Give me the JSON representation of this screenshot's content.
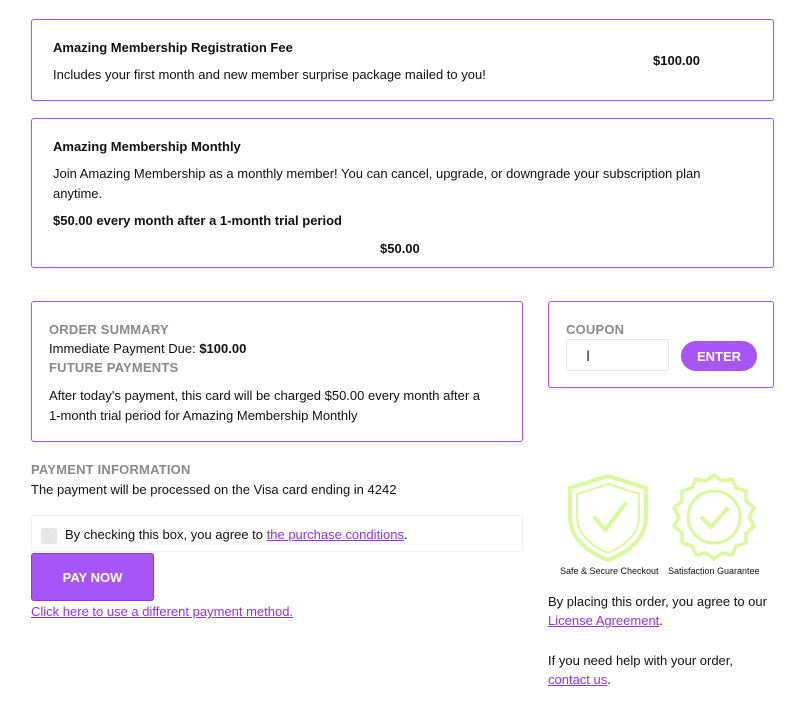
{
  "registration": {
    "title": "Amazing Membership Registration Fee",
    "description": "Includes your first month and new member surprise package mailed to you!",
    "price": "$100.00"
  },
  "monthly": {
    "title": "Amazing Membership Monthly",
    "description_line1": "Join Amazing Membership as a monthly member! You can cancel, upgrade, or downgrade your subscription plan",
    "description_line2": "anytime.",
    "terms": "$50.00 every month after a 1-month trial period",
    "price": "$50.00"
  },
  "order_summary": {
    "heading": "ORDER SUMMARY",
    "due_label": "Immediate Payment Due:",
    "due_amount": "$100.00",
    "future_heading": "FUTURE PAYMENTS",
    "future_line1": "After today's payment, this card will be charged $50.00 every month after a",
    "future_line2": "1-month trial period for Amazing Membership Monthly"
  },
  "coupon": {
    "heading": "COUPON",
    "input_value": "",
    "button_label": "ENTER"
  },
  "payment": {
    "heading": "PAYMENT INFORMATION",
    "card_info": "The payment will be processed on the Visa card ending in 4242",
    "agree_prefix": "By checking this box, you agree to",
    "agree_link": "the purchase conditions",
    "agree_suffix": ".",
    "pay_label": "PAY NOW",
    "alt_method_link": "Click here to use a different payment method."
  },
  "badges": {
    "secure_label": "Safe & Secure Checkout",
    "guarantee_label": "Satisfaction Guarantee",
    "badge_color": "#d9f99d"
  },
  "legal": {
    "license_prefix": "By placing this order, you agree to our",
    "license_link": "License Agreement",
    "license_suffix": ".",
    "help_prefix": "If you need help with your order,",
    "help_link": "contact us",
    "help_suffix": "."
  },
  "colors": {
    "accent": "#a855f7",
    "link": "#9333ea",
    "label_gray": "#8a8a8a"
  }
}
